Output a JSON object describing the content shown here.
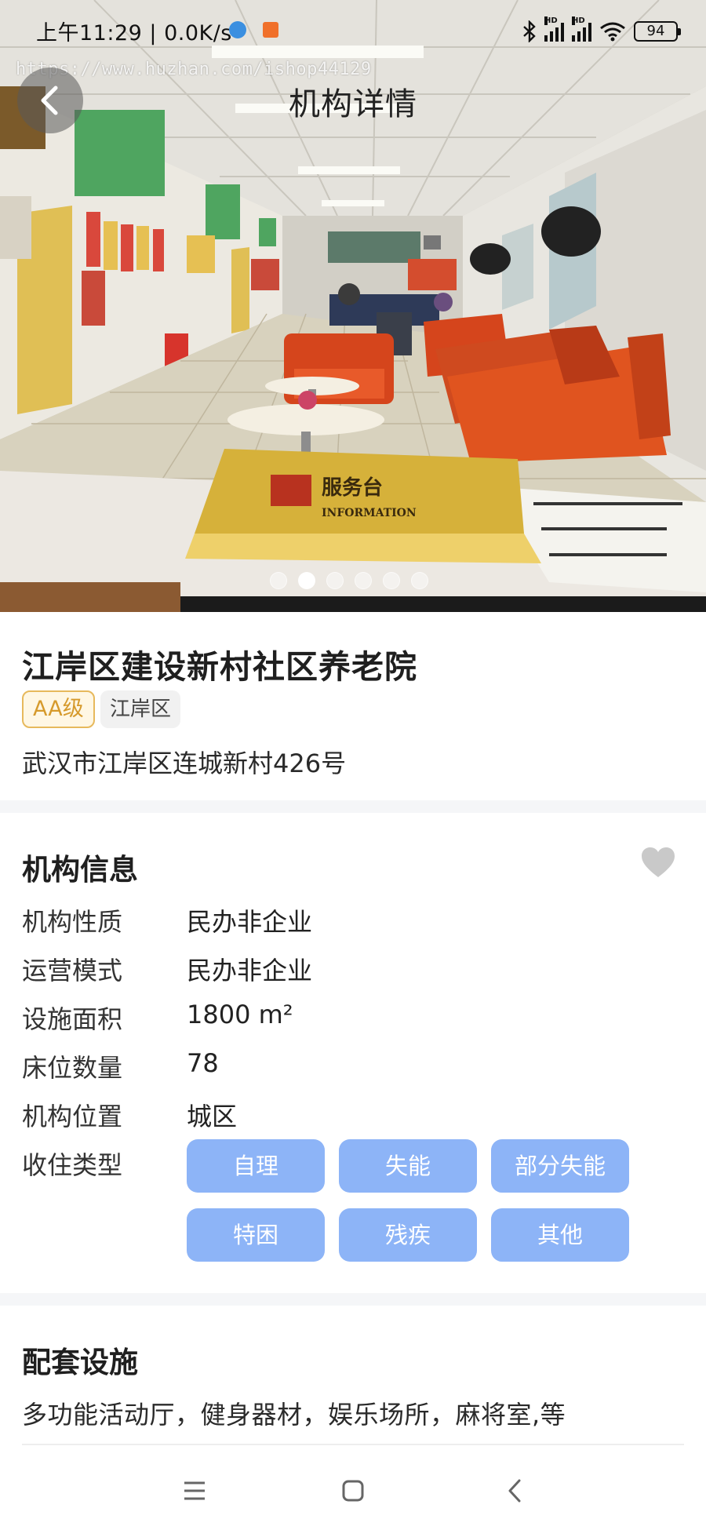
{
  "status_bar": {
    "time": "上午11:29 | 0.0K/s",
    "network_label_1": "HD",
    "network_label_2": "HD",
    "battery": "94",
    "icons": [
      "app-notification-icon",
      "app-notification-icon",
      "bluetooth-icon",
      "signal-icon",
      "signal-icon",
      "wifi-icon",
      "battery-icon"
    ]
  },
  "watermark": "https://www.huzhan.com/ishop44129",
  "header": {
    "title": "机构详情",
    "back_icon": "chevron-left-icon"
  },
  "carousel": {
    "slide_count": 6,
    "active_index": 1,
    "photo_sign_cn": "服务台",
    "photo_sign_en": "INFORMATION"
  },
  "institution": {
    "name": "江岸区建设新村社区养老院",
    "level_badge": "AA级",
    "district_badge": "江岸区",
    "address": "武汉市江岸区连城新村426号"
  },
  "info_section": {
    "title": "机构信息",
    "favorite_icon": "heart-icon",
    "rows": [
      {
        "label": "机构性质",
        "value": "民办非企业"
      },
      {
        "label": "运营模式",
        "value": "民办非企业"
      },
      {
        "label": "设施面积",
        "value": "1800 m²"
      },
      {
        "label": "床位数量",
        "value": "78"
      },
      {
        "label": "机构位置",
        "value": "城区"
      }
    ],
    "admission_label": "收住类型",
    "admission_tags": [
      "自理",
      "失能",
      "部分失能",
      "特困",
      "残疾",
      "其他"
    ]
  },
  "facilities_section": {
    "title": "配套设施",
    "text": "多功能活动厅，健身器材，娱乐场所，麻将室,等"
  },
  "nav_bar": {
    "icons": [
      "menu-icon",
      "home-square-icon",
      "back-arrow-icon"
    ]
  },
  "colors": {
    "tag_bg": "#8db4f7",
    "level_border": "#e7b95c",
    "level_text": "#d69a2c",
    "separator": "#f5f6f8"
  }
}
